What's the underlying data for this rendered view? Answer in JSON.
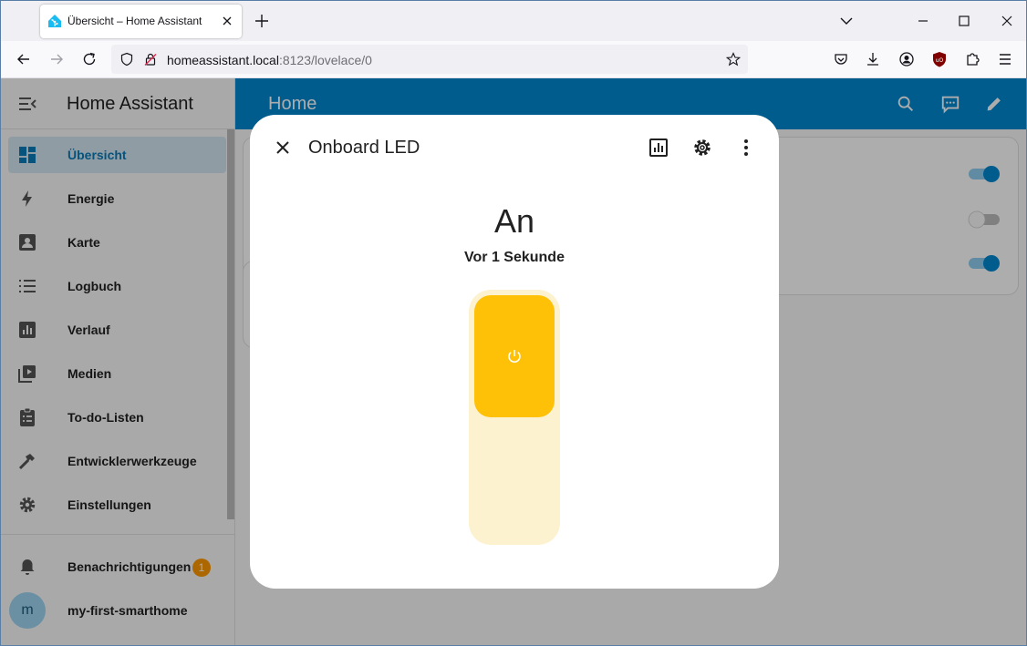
{
  "browser": {
    "tab_title": "Übersicht – Home Assistant",
    "url_host": "homeassistant.local",
    "url_rest": ":8123/lovelace/0"
  },
  "sidebar": {
    "title": "Home Assistant",
    "items": [
      {
        "label": "Übersicht",
        "icon": "dashboard-icon",
        "active": true
      },
      {
        "label": "Energie",
        "icon": "lightning-icon"
      },
      {
        "label": "Karte",
        "icon": "account-box-icon"
      },
      {
        "label": "Logbuch",
        "icon": "list-icon"
      },
      {
        "label": "Verlauf",
        "icon": "chart-box-icon"
      },
      {
        "label": "Medien",
        "icon": "play-box-icon"
      },
      {
        "label": "To-do-Listen",
        "icon": "clipboard-list-icon"
      },
      {
        "label": "Entwicklerwerkzeuge",
        "icon": "hammer-icon"
      },
      {
        "label": "Einstellungen",
        "icon": "gear-icon"
      }
    ],
    "notifications": {
      "label": "Benachrichtigungen",
      "count": "1"
    },
    "user": {
      "label": "my-first-smarthome",
      "initial": "m"
    }
  },
  "topbar": {
    "title": "Home"
  },
  "dialog": {
    "title": "Onboard LED",
    "state": "An",
    "last_changed": "Vor 1 Sekunde",
    "switch_on": true
  },
  "colors": {
    "primary": "#0288d1",
    "accent_on": "#ffc107",
    "badge": "#ff9800"
  }
}
